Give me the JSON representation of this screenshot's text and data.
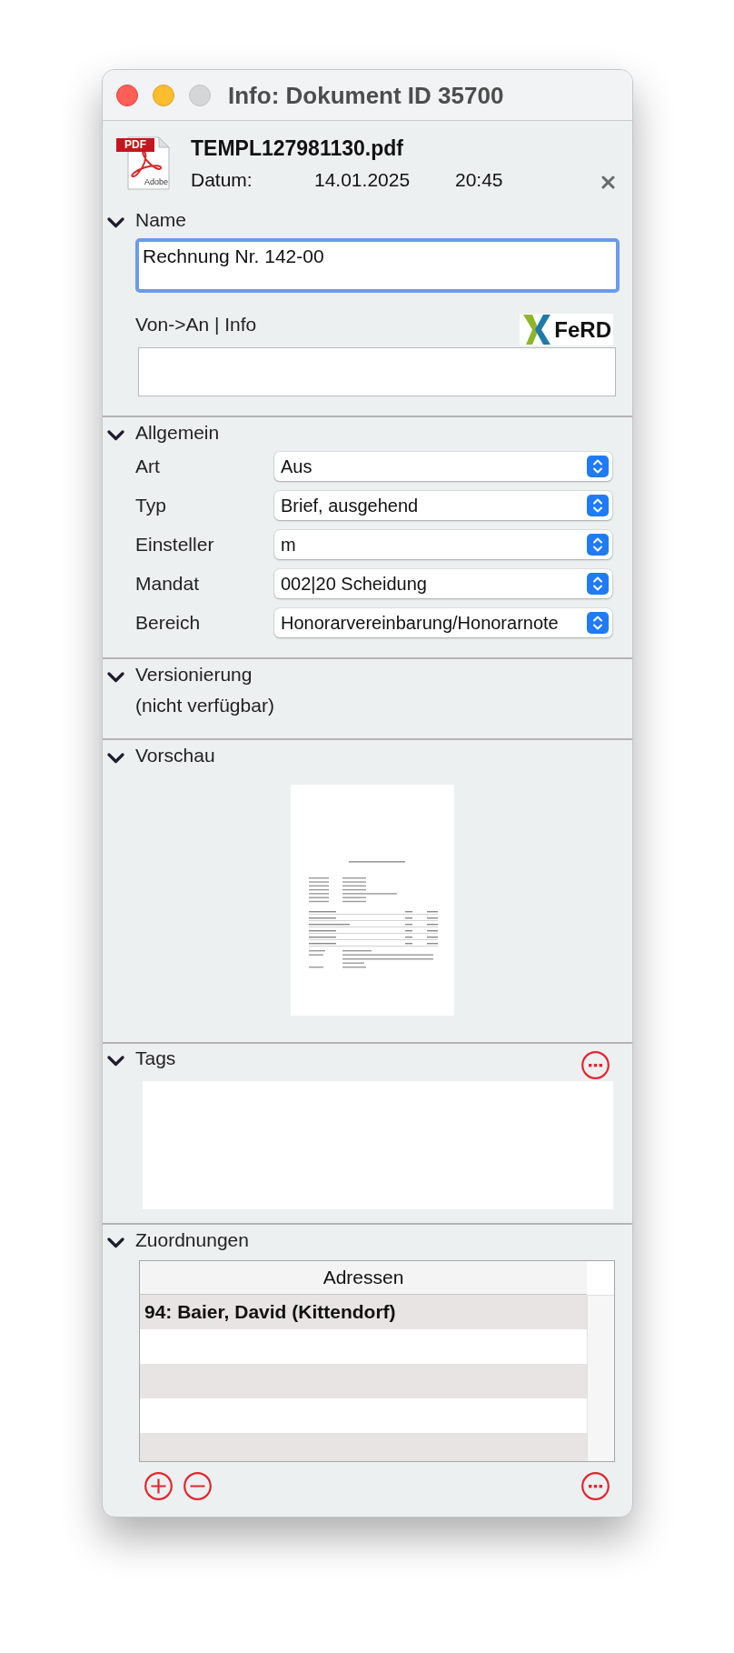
{
  "window": {
    "title": "Info: Dokument ID 35700",
    "controls": [
      {
        "kind": "close",
        "disabled": false
      },
      {
        "kind": "minimize",
        "disabled": false
      },
      {
        "kind": "zoom",
        "disabled": true
      }
    ]
  },
  "document": {
    "file_badge": "PDF",
    "file_caption": "Adobe",
    "filename": "TEMPL127981130.pdf",
    "date_label": "Datum:",
    "date": "14.01.2025",
    "time": "20:45"
  },
  "sections": [
    {
      "kind": "name",
      "title": "Name",
      "expanded": true,
      "value": "Rechnung Nr. 142-00",
      "focused": true,
      "info_label": "Von->An | Info",
      "logo_text": "FeRD"
    },
    {
      "kind": "fields",
      "title": "Allgemein",
      "expanded": true,
      "fields": [
        {
          "label": "Art",
          "value": "Aus"
        },
        {
          "label": "Typ",
          "value": "Brief, ausgehend"
        },
        {
          "label": "Einsteller",
          "value": "m"
        },
        {
          "label": "Mandat",
          "value": "002|20 Scheidung"
        },
        {
          "label": "Bereich",
          "value": "Honorarvereinbarung/Honorarnote"
        }
      ]
    },
    {
      "kind": "note",
      "title": "Versionierung",
      "expanded": true,
      "note": "(nicht verfügbar)"
    },
    {
      "kind": "preview",
      "title": "Vorschau",
      "expanded": true
    },
    {
      "kind": "tags",
      "title": "Tags",
      "expanded": true
    },
    {
      "kind": "table",
      "title": "Zuordnungen",
      "expanded": true,
      "columns": [
        "Adressen"
      ],
      "rows": [
        {
          "cells": [
            "94: Baier, David (Kittendorf)"
          ]
        }
      ]
    }
  ]
}
